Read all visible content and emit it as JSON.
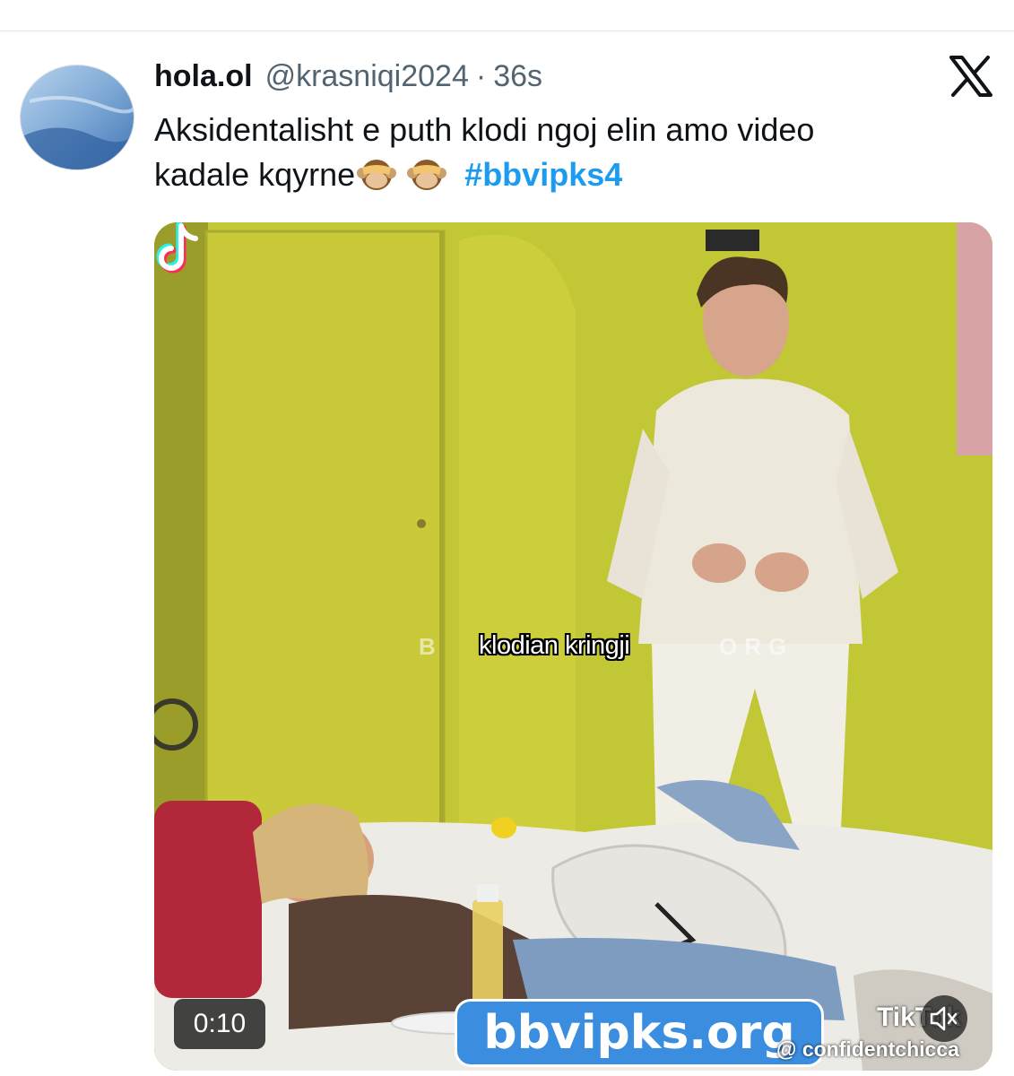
{
  "tweet": {
    "display_name": "hola.ol",
    "handle": "@krasniqi2024",
    "separator": "·",
    "time": "36s",
    "text_line1": "Aksidentalisht e puth klodi ngoj elin amo video",
    "text_line2": "kadale kqyrne",
    "emojis": [
      "see-no-evil-monkey",
      "see-no-evil-monkey"
    ],
    "hashtag": "#bbvipks4",
    "brand_icon": "x-logo"
  },
  "video": {
    "caption": "klodian kringji",
    "watermark_left": "B",
    "watermark_right": "ORG",
    "site_banner": "bbvipks.org",
    "timestamp": "0:10",
    "tiktok_label": "TikTok",
    "tiktok_user": "@ confidentchicca",
    "mute_icon": "speaker-muted-icon"
  },
  "colors": {
    "hashtag": "#1d9bf0",
    "secondary_text": "#536471",
    "banner": "#3b8de0",
    "wall": "#c8cd38"
  }
}
